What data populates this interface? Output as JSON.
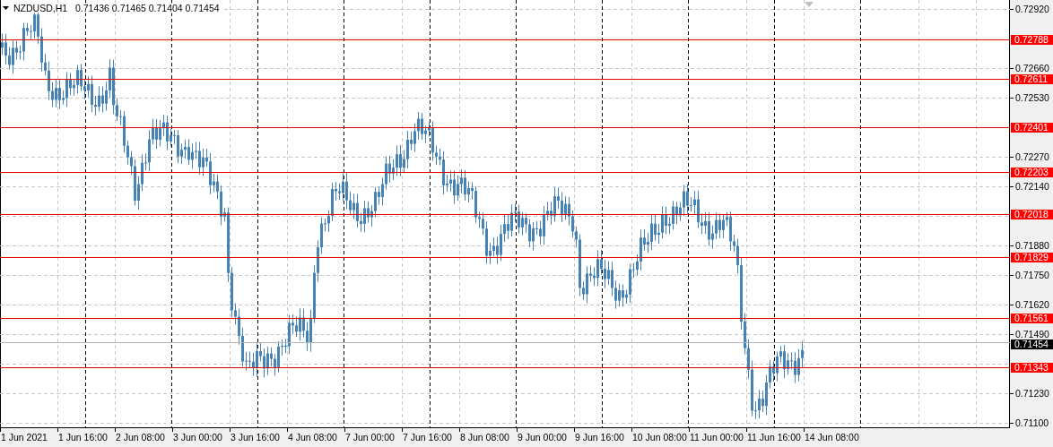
{
  "header": {
    "symbol": "NZDUSD,H1",
    "quotes": [
      "0.71436",
      "0.71465",
      "0.71404",
      "0.71454"
    ]
  },
  "price_axis": [
    "0.72920",
    "0.72660",
    "0.72530",
    "0.72270",
    "0.72140",
    "0.71880",
    "0.71750",
    "0.71620",
    "0.71490",
    "0.71230",
    "0.71100"
  ],
  "levels": [
    {
      "price": "0.72788"
    },
    {
      "price": "0.72611"
    },
    {
      "price": "0.72401"
    },
    {
      "price": "0.72203"
    },
    {
      "price": "0.72018"
    },
    {
      "price": "0.71829"
    },
    {
      "price": "0.71561"
    },
    {
      "price": "0.71343"
    }
  ],
  "bid": {
    "price": "0.71454"
  },
  "time_axis": [
    "1 Jun 2021",
    "1 Jun 16:00",
    "2 Jun 08:00",
    "3 Jun 00:00",
    "3 Jun 16:00",
    "4 Jun 08:00",
    "7 Jun 00:00",
    "7 Jun 16:00",
    "8 Jun 08:00",
    "9 Jun 00:00",
    "9 Jun 16:00",
    "10 Jun 08:00",
    "11 Jun 00:00",
    "11 Jun 16:00",
    "14 Jun 08:00"
  ]
}
